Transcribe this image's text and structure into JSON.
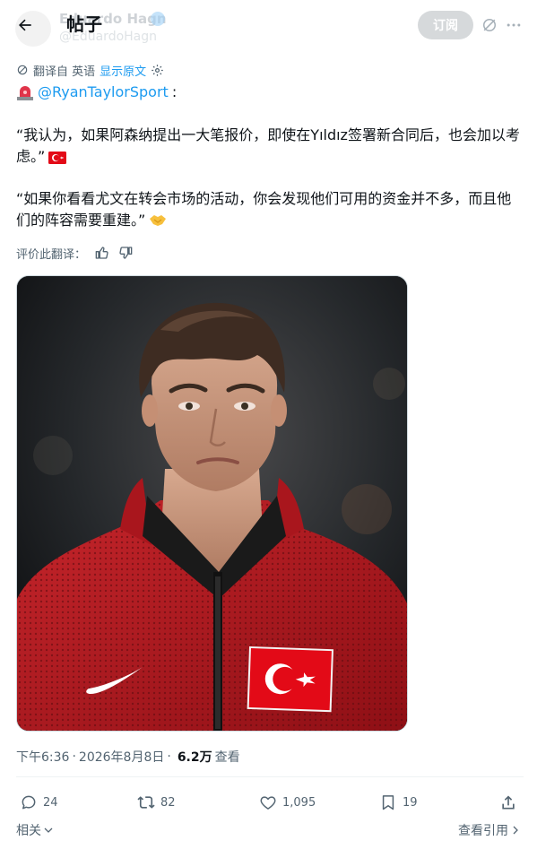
{
  "header": {
    "title": "帖子",
    "author_name": "Eduardo Hagn",
    "author_handle": "@EduardoHagn",
    "subscribe_label": "订阅",
    "back_icon": "arrow-left-icon",
    "grok_icon": "grok-icon",
    "more_icon": "more-horizontal-icon"
  },
  "translation": {
    "label": "翻译自 英语",
    "show_original": "显示原文"
  },
  "post": {
    "mention": "@RyanTaylorSport",
    "mention_suffix": ":",
    "paragraph1": "“我认为，如果阿森纳提出一大笔报价，即使在Yıldız签署新合同后，也会加以考虑。”",
    "paragraph2": "“如果你看看尤文在转会市场的活动，你会发现他们可用的资金并不多，而且他们的阵容需要重建。”"
  },
  "rate": {
    "label": "评价此翻译："
  },
  "meta": {
    "time": "下午6:36",
    "separator": "·",
    "date": "2026年8月8日",
    "views_count": "6.2万",
    "views_label": "查看"
  },
  "actions": {
    "replies": "24",
    "reposts": "82",
    "likes": "1,095",
    "bookmarks": "19"
  },
  "footer": {
    "related": "相关",
    "view_quotes": "查看引用"
  },
  "colors": {
    "accent": "#1d9bf0",
    "secondary_text": "#536471",
    "flag_red": "#e30a17"
  }
}
